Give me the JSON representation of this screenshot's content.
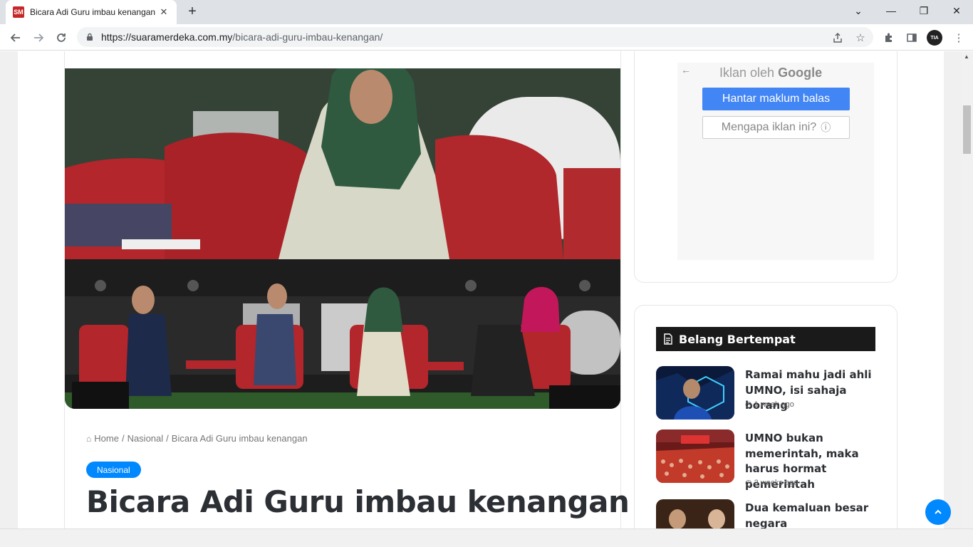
{
  "browser": {
    "tab_title": "Bicara Adi Guru imbau kenangan",
    "favicon_text": "SM",
    "url_host": "https://suaramerdeka.com.my",
    "url_path": "/bicara-adi-guru-imbau-kenangan/",
    "profile_text": "TIA"
  },
  "breadcrumb": {
    "home": "Home",
    "sep1": "/",
    "category": "Nasional",
    "sep2": "/",
    "current": "Bicara Adi Guru imbau kenangan"
  },
  "article": {
    "category_badge": "Nasional",
    "title": "Bicara Adi Guru imbau kenangan"
  },
  "ad": {
    "back_glyph": "←",
    "iklan_oleh": "Iklan oleh",
    "google": "Google",
    "feedback_label": "Hantar maklum balas",
    "why_label": "Mengapa iklan ini?",
    "info_glyph": "ⓘ"
  },
  "widget": {
    "title": "Belang Bertempat",
    "posts": [
      {
        "title": "Ramai mahu jadi ahli UMNO, isi sahaja borang",
        "time": "1 week ago"
      },
      {
        "title": "UMNO bukan memerintah, maka harus hormat pemerintah",
        "time": "3 weeks ago"
      },
      {
        "title": "Dua kemaluan besar negara",
        "time": ""
      }
    ]
  },
  "colors": {
    "accent": "#0088ff",
    "widget_header": "#1a1a1a",
    "ad_button": "#4285f4"
  }
}
